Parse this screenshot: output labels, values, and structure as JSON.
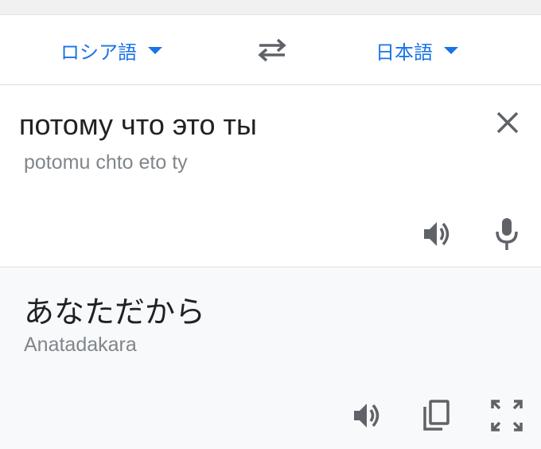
{
  "language_bar": {
    "source_language": "ロシア語",
    "target_language": "日本語"
  },
  "input": {
    "text": "потому что это ты",
    "transliteration": "potomu chto eto ty"
  },
  "output": {
    "text": "あなただから",
    "romanization": "Anatadakara"
  },
  "icons": {
    "swap": "swap-arrows-icon",
    "clear": "close-icon",
    "source_speaker": "speaker-icon",
    "mic": "microphone-icon",
    "target_speaker": "speaker-icon",
    "copy": "copy-icon",
    "fullscreen": "fullscreen-icon"
  },
  "colors": {
    "accent": "#1a73e8",
    "icon": "#5f6368",
    "output_background": "#f8f9fa"
  }
}
